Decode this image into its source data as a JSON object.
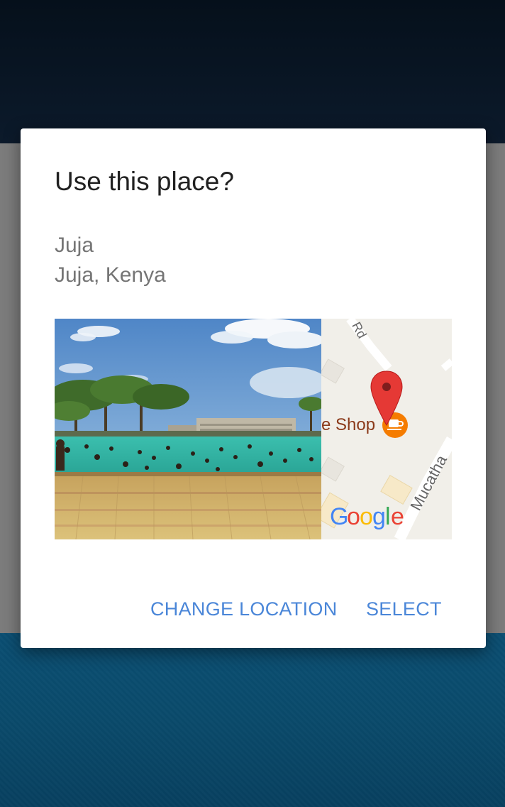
{
  "dialog": {
    "title": "Use this place?",
    "place_name": "Juja",
    "place_address": "Juja, Kenya"
  },
  "map": {
    "poi_label": "e Shop",
    "road_label_top": "Rd",
    "road_label_right": "Mucatha",
    "attribution": "Google",
    "marker_icon": "map-pin-icon",
    "poi_icon": "coffee-cup-icon"
  },
  "photo": {
    "description_icon": "place-photo"
  },
  "actions": {
    "change_location_label": "CHANGE LOCATION",
    "select_label": "SELECT"
  },
  "colors": {
    "accent": "#4a86d8",
    "title": "#212121",
    "secondary_text": "#757575",
    "marker": "#e53935",
    "poi": "#f57c00"
  }
}
